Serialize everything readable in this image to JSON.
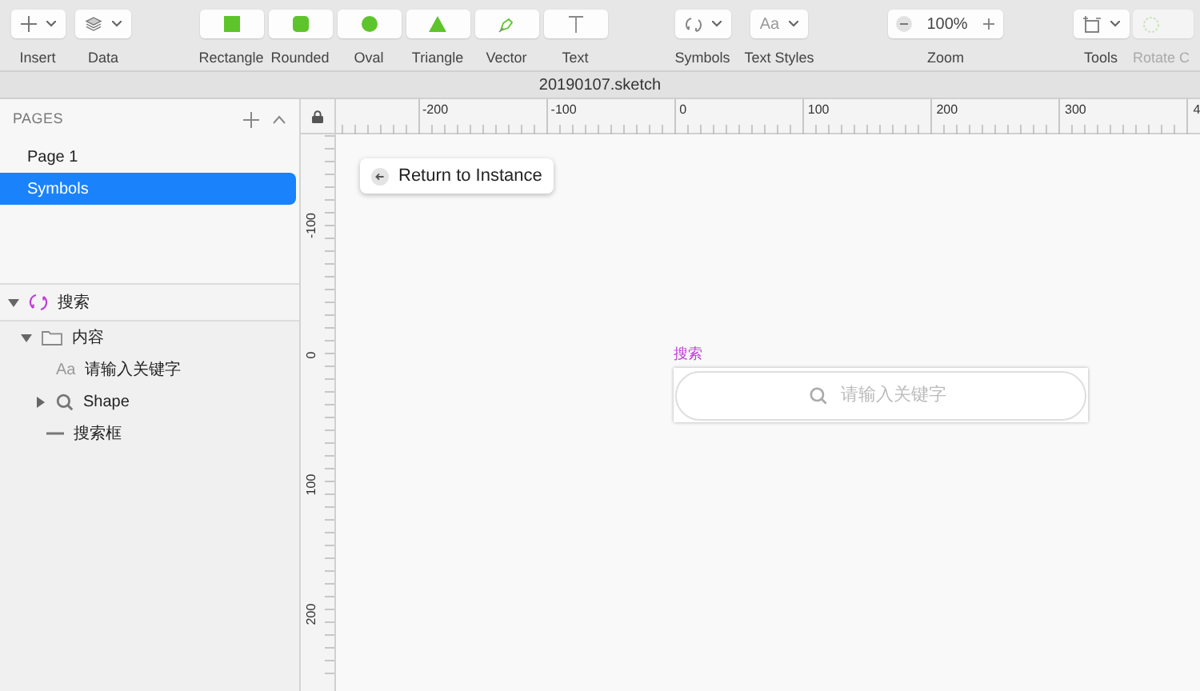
{
  "toolbar": {
    "groups": [
      {
        "items": [
          {
            "kind": "insert",
            "label": "Insert",
            "disabled": false
          },
          {
            "kind": "data",
            "label": "Data",
            "disabled": false
          }
        ]
      },
      {
        "items": [
          {
            "kind": "rectangle",
            "label": "Rectangle",
            "disabled": false
          },
          {
            "kind": "rounded",
            "label": "Rounded",
            "disabled": false
          },
          {
            "kind": "oval",
            "label": "Oval",
            "disabled": false
          },
          {
            "kind": "triangle",
            "label": "Triangle",
            "disabled": false
          },
          {
            "kind": "vector",
            "label": "Vector",
            "disabled": false
          },
          {
            "kind": "text",
            "label": "Text",
            "disabled": false
          }
        ]
      },
      {
        "items": [
          {
            "kind": "symbols",
            "label": "Symbols",
            "disabled": false
          },
          {
            "kind": "text_styles",
            "label": "Text Styles",
            "glyph": "Aa",
            "disabled": false
          }
        ]
      },
      {
        "items": [
          {
            "kind": "zoom",
            "label": "Zoom",
            "value": "100%",
            "disabled": false
          }
        ]
      },
      {
        "items": [
          {
            "kind": "tools",
            "label": "Tools",
            "disabled": false
          },
          {
            "kind": "rotate",
            "label": "Rotate C",
            "disabled": true
          }
        ]
      }
    ]
  },
  "window": {
    "title": "20190107.sketch"
  },
  "pages": {
    "header": "PAGES",
    "items": [
      {
        "label": "Page 1",
        "selected": false
      },
      {
        "label": "Symbols",
        "selected": true
      }
    ]
  },
  "layers": [
    {
      "kind": "symbol",
      "name": "搜索",
      "expanded": true,
      "children": [
        {
          "kind": "group",
          "name": "内容",
          "expanded": true,
          "children": [
            {
              "kind": "text",
              "icon_text": "Aa",
              "name": "请输入关键字"
            },
            {
              "kind": "shape",
              "name": "Shape",
              "expanded": false
            },
            {
              "kind": "line",
              "name": "搜索框"
            }
          ]
        }
      ]
    }
  ],
  "rulers": {
    "horizontal": [
      "-200",
      "-100",
      "0",
      "100",
      "200",
      "300",
      "4"
    ],
    "vertical": [
      "-100",
      "0",
      "100",
      "200"
    ]
  },
  "canvas": {
    "return_button": "Return to Instance",
    "artboard": {
      "title": "搜索",
      "search": {
        "placeholder": "请输入关键字"
      }
    }
  }
}
